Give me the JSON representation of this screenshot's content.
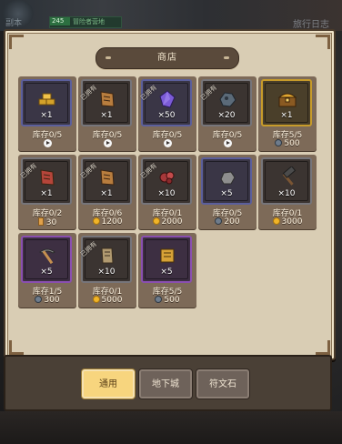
{
  "background": {
    "top_left_label": "副本",
    "top_bar_number": "245",
    "top_bar_text": "冒险者营地",
    "top_right_label": "旅行日志"
  },
  "shop": {
    "title": "商店",
    "owned_tag": "已拥有"
  },
  "items": [
    {
      "name": "gold-bars-icon",
      "qty": "×1",
      "stock": "库存0/5",
      "price_type": "ad",
      "price": "",
      "frame": "blue",
      "owned": false,
      "color": "#d4a22a"
    },
    {
      "name": "scroll-icon",
      "qty": "×1",
      "stock": "库存0/5",
      "price_type": "ad",
      "price": "",
      "frame": "gray",
      "owned": true,
      "color": "#b87d3e"
    },
    {
      "name": "purple-crystal-icon",
      "qty": "×50",
      "stock": "库存0/5",
      "price_type": "ad",
      "price": "",
      "frame": "blue",
      "owned": true,
      "color": "#7b5bd6"
    },
    {
      "name": "dark-ore-icon",
      "qty": "×20",
      "stock": "库存0/5",
      "price_type": "ad",
      "price": "",
      "frame": "gray",
      "owned": true,
      "color": "#5b6a78"
    },
    {
      "name": "treasure-chest-icon",
      "qty": "×1",
      "stock": "库存5/5",
      "price_type": "gem",
      "price": "500",
      "frame": "gold",
      "owned": false,
      "color": "#e0a630"
    },
    {
      "name": "red-scroll-icon",
      "qty": "×1",
      "stock": "库存0/2",
      "price_type": "ticket",
      "price": "30",
      "frame": "gray",
      "owned": true,
      "color": "#b5453a"
    },
    {
      "name": "scroll-icon",
      "qty": "×1",
      "stock": "库存0/6",
      "price_type": "gold",
      "price": "1200",
      "frame": "gray",
      "owned": true,
      "color": "#b87d3e"
    },
    {
      "name": "red-ore-icon",
      "qty": "×10",
      "stock": "库存0/1",
      "price_type": "gold",
      "price": "2000",
      "frame": "gray",
      "owned": true,
      "color": "#a7383a"
    },
    {
      "name": "gray-stone-icon",
      "qty": "×5",
      "stock": "库存0/5",
      "price_type": "gem",
      "price": "200",
      "frame": "blue",
      "owned": false,
      "color": "#8e8e8e"
    },
    {
      "name": "hammer-icon",
      "qty": "×10",
      "stock": "库存0/1",
      "price_type": "gold",
      "price": "3000",
      "frame": "gray",
      "owned": false,
      "color": "#7a5533"
    },
    {
      "name": "pickaxe-icon",
      "qty": "×5",
      "stock": "库存1/5",
      "price_type": "gem",
      "price": "300",
      "frame": "purple",
      "owned": false,
      "color": "#c58f4f"
    },
    {
      "name": "paper-note-icon",
      "qty": "×10",
      "stock": "库存0/1",
      "price_type": "gold",
      "price": "5000",
      "frame": "gray",
      "owned": true,
      "color": "#b19a70"
    },
    {
      "name": "golden-scroll-icon",
      "qty": "×5",
      "stock": "库存5/5",
      "price_type": "gem",
      "price": "500",
      "frame": "purple",
      "owned": false,
      "color": "#d7a237"
    }
  ],
  "tabs": {
    "general": "通用",
    "dungeon": "地下城",
    "rune": "符文石"
  }
}
